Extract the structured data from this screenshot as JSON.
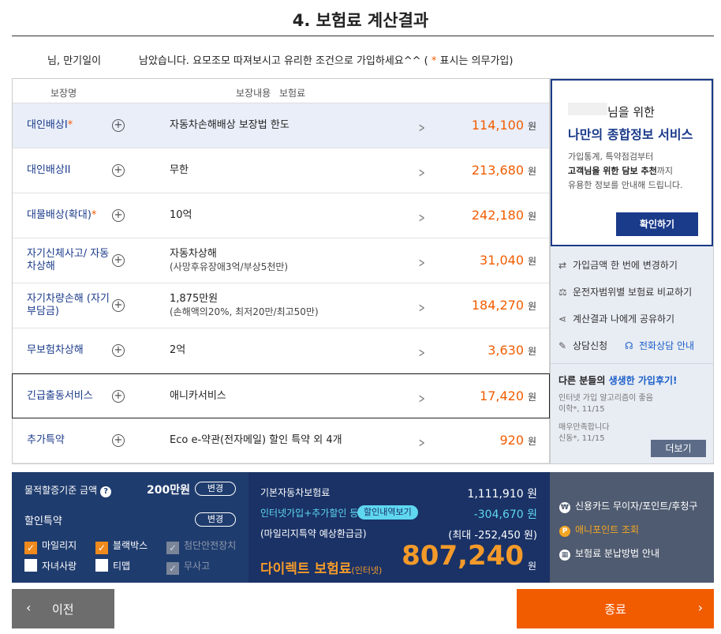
{
  "title": "4. 보험료 계산결과",
  "greeting": {
    "name": "님, 만기일이",
    "message_pre": "남았습니다. 요모조모 따져보시고 유리한 조건으로 가입하세요^^ (",
    "star": "*",
    "message_post": " 표시는 의무가입)"
  },
  "table": {
    "headers": {
      "name": "보장명",
      "content": "보장내용",
      "premium": "보험료"
    },
    "rows": [
      {
        "name": "대인배상I",
        "star": "*",
        "content": "자동차손해배상 보장법 한도",
        "sub": "",
        "price": "114,100",
        "unit": "원"
      },
      {
        "name": "대인배상II",
        "star": "",
        "content": "무한",
        "sub": "",
        "price": "213,680",
        "unit": "원"
      },
      {
        "name": "대물배상(확대)",
        "star": "*",
        "content": "10억",
        "sub": "",
        "price": "242,180",
        "unit": "원"
      },
      {
        "name": "자기신체사고/ 자동차상해",
        "star": "",
        "content": "자동차상해",
        "sub": "(사망후유장애3억/부상5천만)",
        "price": "31,040",
        "unit": "원"
      },
      {
        "name": "자기차량손해 (자기부담금)",
        "star": "",
        "content": "1,875만원",
        "sub": "(손해액의20%, 최저20만/최고50만)",
        "price": "184,270",
        "unit": "원"
      },
      {
        "name": "무보험차상해",
        "star": "",
        "content": "2억",
        "sub": "",
        "price": "3,630",
        "unit": "원"
      },
      {
        "name": "긴급출동서비스",
        "star": "",
        "content": "애니카서비스",
        "sub": "",
        "price": "17,420",
        "unit": "원"
      },
      {
        "name": "추가특약",
        "star": "",
        "content": "Eco e-약관(전자메일) 할인 특약 외 4개",
        "sub": "",
        "price": "920",
        "unit": "원"
      }
    ]
  },
  "promo": {
    "line1": "님을 위한",
    "line2": "나만의 종합정보 서비스",
    "desc1": "가입통계, 특약점검부터",
    "desc2_bold": "고객님을 위한 담보 추천",
    "desc2_rest": "까지",
    "desc3": "유용한 정보를 안내해 드립니다.",
    "button": "확인하기"
  },
  "side_links": {
    "change": "가입금액 한 번에 변경하기",
    "compare": "운전자범위별 보험료 비교하기",
    "share": "계산결과 나에게 공유하기",
    "consult": "상담신청",
    "phone": "전화상담 안내"
  },
  "reviews": {
    "title_pre": "다른 분들의 ",
    "title_hl": "생생한 가입후기!",
    "items": [
      {
        "text": "인터넷 가입 알고리즘이 좋음",
        "meta": "이학*, 11/15"
      },
      {
        "text": "매우만족합니다",
        "meta": "신동*, 11/15"
      }
    ],
    "more": "더보기"
  },
  "options": {
    "property_label": "물적할증기준 금액",
    "property_value": "200만원",
    "change": "변경",
    "discount_label": "할인특약",
    "checkboxes": [
      {
        "label": "마일리지",
        "state": "checked"
      },
      {
        "label": "블랙박스",
        "state": "checked"
      },
      {
        "label": "첨단안전장치",
        "state": "disabled"
      },
      {
        "label": "자녀사랑",
        "state": "unchecked"
      },
      {
        "label": "티맵",
        "state": "unchecked"
      },
      {
        "label": "무사고",
        "state": "disabled"
      }
    ]
  },
  "summary": {
    "base_label": "기본자동차보험료",
    "base_value": "1,111,910 원",
    "discount_label": "인터넷가입+추가할인 등",
    "discount_tag": "할인내역보기",
    "discount_value": "-304,670 원",
    "mileage_label": "(마일리지특약 예상환급금)",
    "mileage_value": "(최대 -252,450 원)",
    "final_label": "다이렉트 보험료",
    "final_small": "(인터넷)",
    "final_value": "807,240",
    "final_unit": "원"
  },
  "payment": {
    "card": "신용카드 무이자/포인트/후청구",
    "points": "애니포인트 조회",
    "installment": "보험료 분납방법 안내"
  },
  "nav": {
    "prev": "이전",
    "next": "종료"
  },
  "colors": {
    "accent": "#f25c00",
    "navy": "#1a3a8a"
  }
}
